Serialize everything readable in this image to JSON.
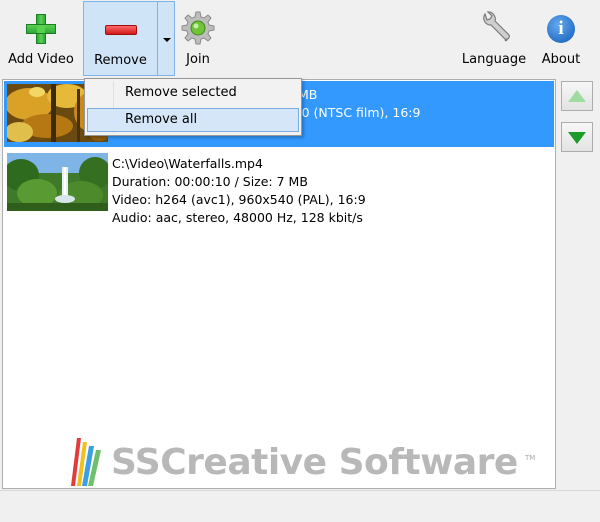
{
  "toolbar": {
    "add_video": "Add Video",
    "remove": "Remove",
    "join": "Join",
    "language": "Language",
    "about": "About",
    "about_glyph": "i"
  },
  "remove_menu": {
    "items": [
      {
        "label": "Remove selected"
      },
      {
        "label": "Remove all"
      }
    ]
  },
  "list": {
    "items": [
      {
        "path": "",
        "duration": "MB",
        "video": "Video: h264 (avc1), 1920x1080 (NTSC film), 16:9",
        "audio": "",
        "selected": true
      },
      {
        "path": "C:\\Video\\Waterfalls.mp4",
        "duration": "Duration: 00:00:10 / Size: 7 MB",
        "video": "Video: h264 (avc1), 960x540 (PAL), 16:9",
        "audio": "Audio: aac, stereo, 48000 Hz, 128 kbit/s",
        "selected": false
      }
    ]
  },
  "watermark": {
    "text": "SSCreative Software",
    "tm": "TM"
  },
  "colors": {
    "selection": "#3399ff",
    "remove_pressed_bg": "#cfe4f7",
    "menu_hover_bg": "#d5e6f8",
    "move_down_arrow": "#1a9b2a",
    "move_up_arrow": "#9fdc9f"
  },
  "icons": {
    "add_video": "green-plus-icon",
    "remove": "red-minus-icon",
    "join": "gear-icon",
    "language": "wrench-icon",
    "about": "info-icon",
    "move_up": "triangle-up-icon",
    "move_down": "triangle-down-icon"
  }
}
